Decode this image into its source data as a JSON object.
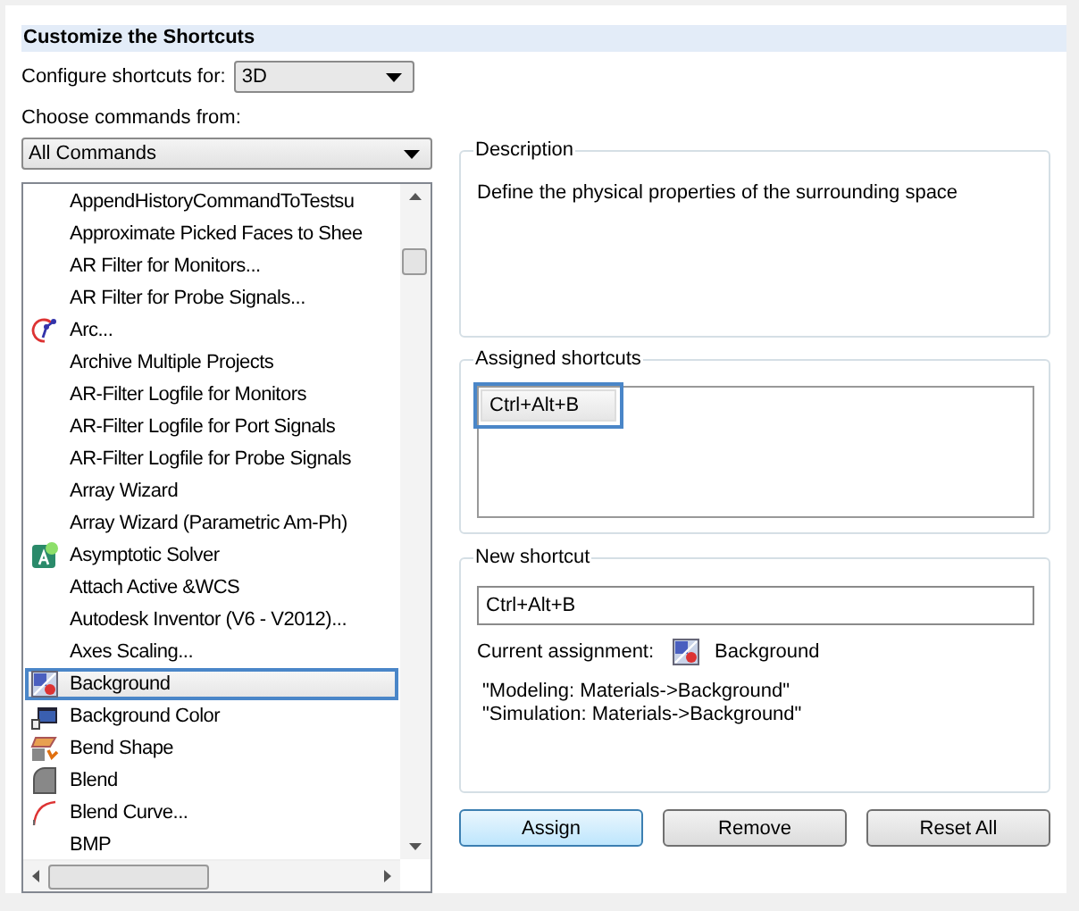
{
  "title": "Customize the Shortcuts",
  "configure": {
    "label": "Configure shortcuts for:",
    "value": "3D"
  },
  "commands": {
    "label": "Choose commands from:",
    "value": "All Commands"
  },
  "command_list": [
    {
      "label": "AppendHistoryCommandToTestsu",
      "kind": "plain",
      "selected": false
    },
    {
      "label": "Approximate Picked Faces to Shee",
      "kind": "plain",
      "selected": false
    },
    {
      "label": "AR Filter for Monitors...",
      "kind": "plain",
      "selected": false
    },
    {
      "label": "AR Filter for Probe Signals...",
      "kind": "plain",
      "selected": false
    },
    {
      "label": "Arc...",
      "kind": "arc",
      "selected": false
    },
    {
      "label": "Archive Multiple Projects",
      "kind": "plain",
      "selected": false
    },
    {
      "label": "AR-Filter Logfile for Monitors",
      "kind": "plain",
      "selected": false
    },
    {
      "label": "AR-Filter Logfile for Port Signals",
      "kind": "plain",
      "selected": false
    },
    {
      "label": "AR-Filter Logfile for Probe Signals",
      "kind": "plain",
      "selected": false
    },
    {
      "label": "Array Wizard",
      "kind": "plain",
      "selected": false
    },
    {
      "label": "Array Wizard (Parametric Am-Ph)",
      "kind": "plain",
      "selected": false
    },
    {
      "label": "Asymptotic Solver",
      "kind": "solver",
      "selected": false
    },
    {
      "label": "Attach Active &WCS",
      "kind": "plain",
      "selected": false
    },
    {
      "label": "Autodesk Inventor (V6 - V2012)...",
      "kind": "plain",
      "selected": false
    },
    {
      "label": "Axes Scaling...",
      "kind": "plain",
      "selected": false
    },
    {
      "label": "Background",
      "kind": "background",
      "selected": true
    },
    {
      "label": "Background Color",
      "kind": "color",
      "selected": false
    },
    {
      "label": "Bend Shape",
      "kind": "bend",
      "selected": false
    },
    {
      "label": "Blend",
      "kind": "blend",
      "selected": false
    },
    {
      "label": "Blend Curve...",
      "kind": "curve",
      "selected": false
    },
    {
      "label": "BMP",
      "kind": "plain",
      "selected": false
    }
  ],
  "description": {
    "title": "Description",
    "text": "Define the physical properties of the surrounding space"
  },
  "assigned": {
    "title": "Assigned shortcuts",
    "items": [
      {
        "label": "Ctrl+Alt+B",
        "selected": true
      }
    ]
  },
  "new_shortcut": {
    "title": "New shortcut",
    "value": "Ctrl+Alt+B",
    "current_label": "Current assignment:",
    "current_value": "Background",
    "notes": [
      "\"Modeling: Materials->Background\"",
      "\"Simulation: Materials->Background\""
    ]
  },
  "buttons": [
    "Assign",
    "Remove",
    "Reset All"
  ]
}
